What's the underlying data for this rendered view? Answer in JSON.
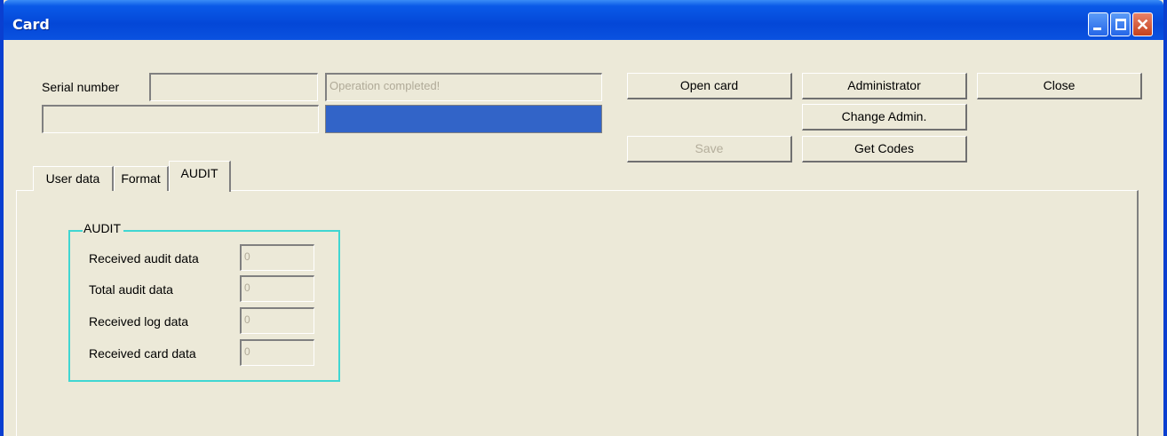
{
  "window": {
    "title": "Card"
  },
  "header": {
    "serial_label": "Serial number",
    "serial_value": "",
    "status_text": "Operation completed!",
    "secondary_field": "",
    "progress_percent": 100
  },
  "buttons": {
    "open_card": "Open card",
    "administrator": "Administrator",
    "close": "Close",
    "change_admin": "Change Admin.",
    "save": "Save",
    "get_codes": "Get Codes"
  },
  "tabs": [
    {
      "label": "User data"
    },
    {
      "label": "Format"
    },
    {
      "label": "AUDIT",
      "active": true
    }
  ],
  "audit": {
    "group_title": "AUDIT",
    "rows": [
      {
        "label": "Received audit data",
        "value": "0"
      },
      {
        "label": "Total audit data",
        "value": "0"
      },
      {
        "label": "Received log data",
        "value": "0"
      },
      {
        "label": "Received card data",
        "value": "0"
      }
    ]
  },
  "icons": {
    "minimize": "minimize-icon",
    "maximize": "maximize-icon",
    "close": "close-icon"
  },
  "colors": {
    "titlebar": "#0447d7",
    "progress": "#3264c8",
    "groupbox_border": "#40d6d2"
  }
}
